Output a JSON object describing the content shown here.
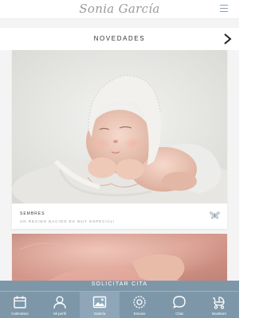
{
  "header": {
    "logo_text": "Sonia García"
  },
  "section": {
    "title": "NOVEDADES"
  },
  "cards": [
    {
      "date": "SEMBRES",
      "subtitle": "UN RECIEN NACIDO ES MUY ESPECIAL!"
    }
  ],
  "cta": {
    "label": "SOLICITAR CITA"
  },
  "tabbar": {
    "items": [
      {
        "label": "Calendario",
        "icon": "calendar-icon"
      },
      {
        "label": "Mi perfil",
        "icon": "user-icon"
      },
      {
        "label": "Galería",
        "icon": "gallery-icon"
      },
      {
        "label": "Emoxis",
        "icon": "settings-icon"
      },
      {
        "label": "Chat",
        "icon": "chat-icon"
      },
      {
        "label": "Newborn",
        "icon": "stroller-icon"
      }
    ]
  },
  "colors": {
    "accent": "#7d97a9",
    "background": "#f4f4f4"
  }
}
